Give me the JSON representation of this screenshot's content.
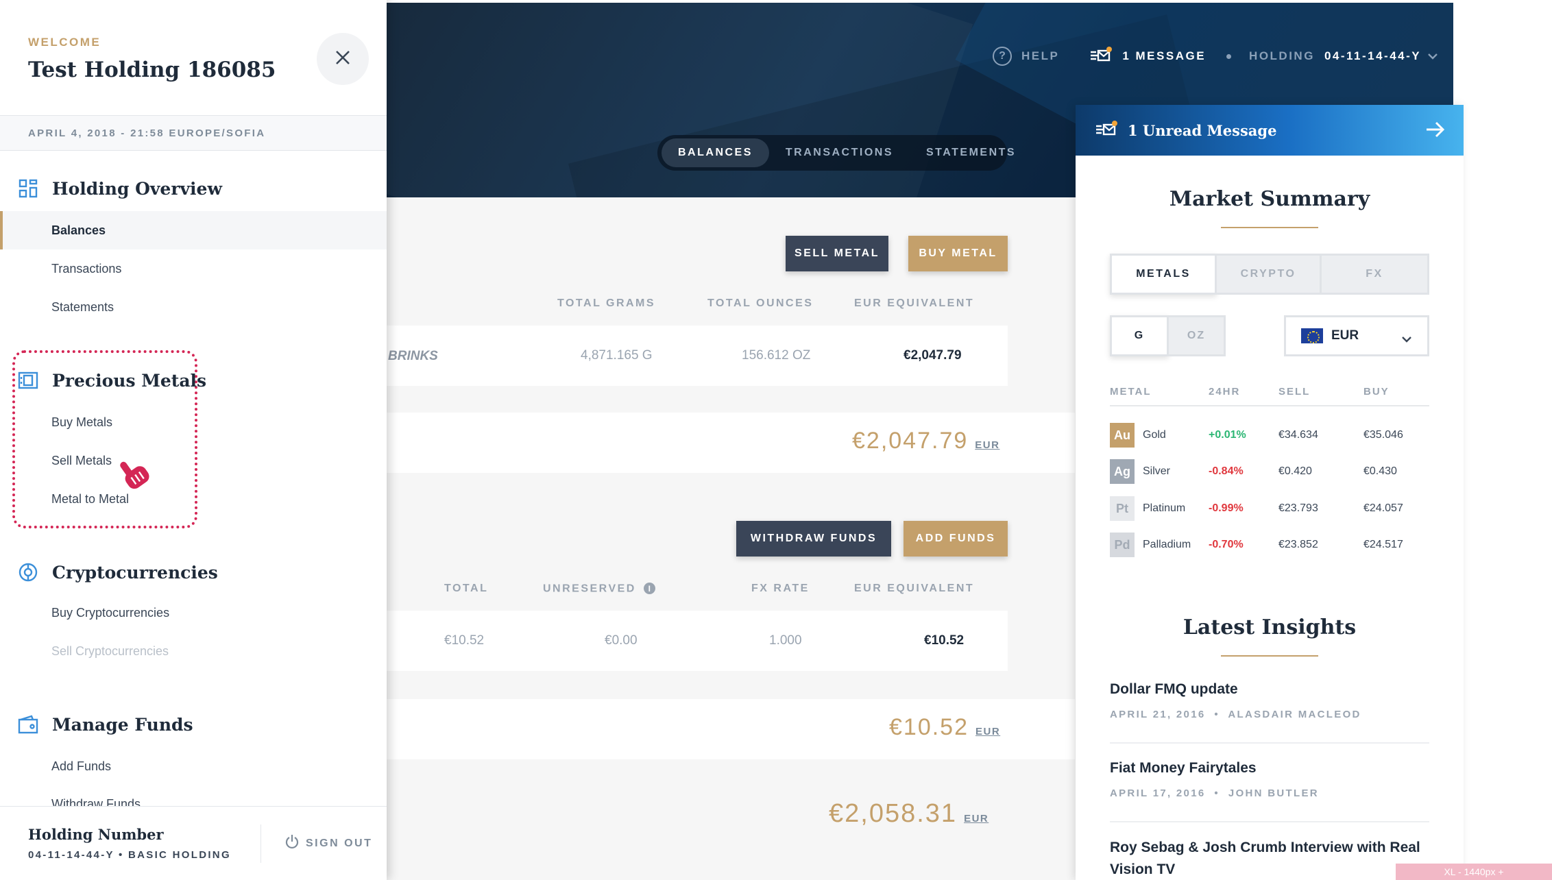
{
  "header": {
    "help_label": "HELP",
    "message_label": "1 MESSAGE",
    "holding_label": "HOLDING",
    "holding_value": "04-11-14-44-Y",
    "tabs": [
      "BALANCES",
      "TRANSACTIONS",
      "STATEMENTS"
    ]
  },
  "metals_section": {
    "sell_button": "SELL METAL",
    "buy_button": "BUY METAL",
    "columns": [
      "TOTAL GRAMS",
      "TOTAL OUNCES",
      "EUR EQUIVALENT"
    ],
    "row": {
      "vault": "BRINKS",
      "grams": "4,871.165 G",
      "ounces": "156.612 OZ",
      "eur": "€2,047.79"
    },
    "total_amount": "€2,047.79",
    "total_currency": "EUR"
  },
  "funds_section": {
    "withdraw_button": "WITHDRAW FUNDS",
    "add_button": "ADD FUNDS",
    "columns": [
      "TOTAL",
      "UNRESERVED",
      "FX RATE",
      "EUR EQUIVALENT"
    ],
    "row": {
      "total": "€10.52",
      "unreserved": "€0.00",
      "fx_rate": "1.000",
      "eur": "€10.52"
    },
    "total_amount": "€10.52",
    "total_currency": "EUR"
  },
  "grand_total": {
    "amount": "€2,058.31",
    "currency": "EUR"
  },
  "sidebar": {
    "welcome": "WELCOME",
    "holding_name": "Test Holding 186085",
    "datetime": "APRIL 4, 2018 - 21:58 EUROPE/SOFIA",
    "sections": [
      {
        "title": "Holding Overview",
        "items": [
          "Balances",
          "Transactions",
          "Statements"
        ]
      },
      {
        "title": "Precious Metals",
        "items": [
          "Buy Metals",
          "Sell Metals",
          "Metal to Metal"
        ]
      },
      {
        "title": "Cryptocurrencies",
        "items": [
          "Buy Cryptocurrencies",
          "Sell Cryptocurrencies"
        ]
      },
      {
        "title": "Manage Funds",
        "items": [
          "Add Funds",
          "Withdraw Funds"
        ]
      }
    ],
    "footer": {
      "holding_number_label": "Holding Number",
      "holding_number": "04-11-14-44-Y • BASIC HOLDING",
      "sign_out": "SIGN OUT"
    }
  },
  "right_panel": {
    "unread": "1 Unread Message",
    "market_title": "Market Summary",
    "segments": [
      "METALS",
      "CRYPTO",
      "FX"
    ],
    "units": [
      "G",
      "OZ"
    ],
    "currency": "EUR",
    "table_headers": [
      "METAL",
      "24HR",
      "SELL",
      "BUY"
    ],
    "metals": [
      {
        "symbol": "Au",
        "name": "Gold",
        "change": "+0.01%",
        "sell": "€34.634",
        "buy": "€35.046",
        "color": "#c4a06b",
        "change_color": "#2bb673"
      },
      {
        "symbol": "Ag",
        "name": "Silver",
        "change": "-0.84%",
        "sell": "€0.420",
        "buy": "€0.430",
        "color": "#9fa8b3",
        "change_color": "#e0383e"
      },
      {
        "symbol": "Pt",
        "name": "Platinum",
        "change": "-0.99%",
        "sell": "€23.793",
        "buy": "€24.057",
        "color": "#e7e9ec",
        "change_color": "#e0383e"
      },
      {
        "symbol": "Pd",
        "name": "Palladium",
        "change": "-0.70%",
        "sell": "€23.852",
        "buy": "€24.517",
        "color": "#d6d9de",
        "change_color": "#e0383e"
      }
    ],
    "insights_title": "Latest Insights",
    "insights": [
      {
        "title": "Dollar FMQ update",
        "date": "APRIL 21, 2016",
        "author": "ALASDAIR MACLEOD"
      },
      {
        "title": "Fiat Money Fairytales",
        "date": "APRIL 17, 2016",
        "author": "JOHN BUTLER"
      },
      {
        "title": "Roy Sebag & Josh Crumb Interview with Real Vision TV"
      }
    ]
  },
  "breakpoint_badge": "XL - 1440px +"
}
